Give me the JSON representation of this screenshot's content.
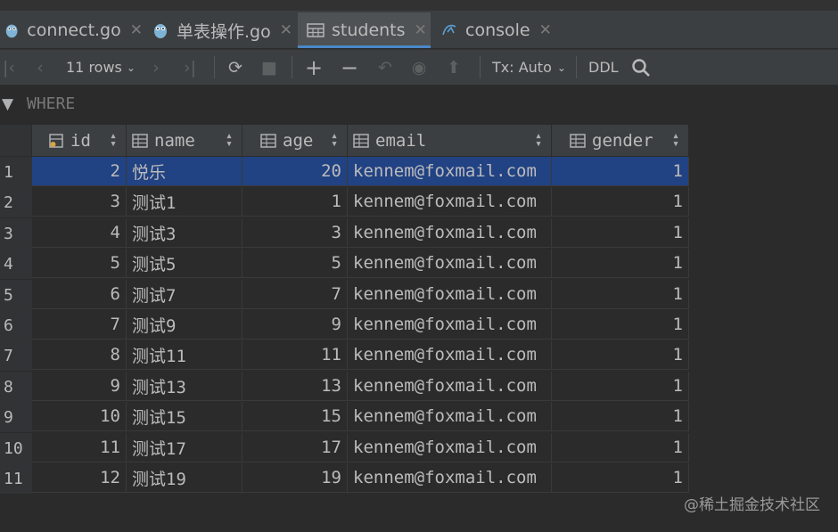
{
  "tabs": [
    {
      "label": "connect.go",
      "icon": "gopher-icon",
      "active": false
    },
    {
      "label": "单表操作.go",
      "icon": "gopher-icon",
      "active": false
    },
    {
      "label": "students",
      "icon": "table-icon",
      "active": true
    },
    {
      "label": "console",
      "icon": "console-icon",
      "active": false
    }
  ],
  "toolbar": {
    "rows_label": "11 rows",
    "tx_label": "Tx: Auto",
    "ddl_label": "DDL"
  },
  "where_label": "WHERE",
  "columns": [
    "id",
    "name",
    "age",
    "email",
    "gender"
  ],
  "rows": [
    {
      "num": "1",
      "id": "2",
      "name": "悦乐",
      "age": "20",
      "email": "kennem@foxmail.com",
      "gender": "1"
    },
    {
      "num": "2",
      "id": "3",
      "name": "测试1",
      "age": "1",
      "email": "kennem@foxmail.com",
      "gender": "1"
    },
    {
      "num": "3",
      "id": "4",
      "name": "测试3",
      "age": "3",
      "email": "kennem@foxmail.com",
      "gender": "1"
    },
    {
      "num": "4",
      "id": "5",
      "name": "测试5",
      "age": "5",
      "email": "kennem@foxmail.com",
      "gender": "1"
    },
    {
      "num": "5",
      "id": "6",
      "name": "测试7",
      "age": "7",
      "email": "kennem@foxmail.com",
      "gender": "1"
    },
    {
      "num": "6",
      "id": "7",
      "name": "测试9",
      "age": "9",
      "email": "kennem@foxmail.com",
      "gender": "1"
    },
    {
      "num": "7",
      "id": "8",
      "name": "测试11",
      "age": "11",
      "email": "kennem@foxmail.com",
      "gender": "1"
    },
    {
      "num": "8",
      "id": "9",
      "name": "测试13",
      "age": "13",
      "email": "kennem@foxmail.com",
      "gender": "1"
    },
    {
      "num": "9",
      "id": "10",
      "name": "测试15",
      "age": "15",
      "email": "kennem@foxmail.com",
      "gender": "1"
    },
    {
      "num": "10",
      "id": "11",
      "name": "测试17",
      "age": "17",
      "email": "kennem@foxmail.com",
      "gender": "1"
    },
    {
      "num": "11",
      "id": "12",
      "name": "测试19",
      "age": "19",
      "email": "kennem@foxmail.com",
      "gender": "1"
    }
  ],
  "selected_row": 0,
  "watermark": "@稀土掘金技术社区",
  "colors": {
    "selection": "#214283",
    "tab_accent": "#4a88c7",
    "background": "#2b2b2b"
  }
}
